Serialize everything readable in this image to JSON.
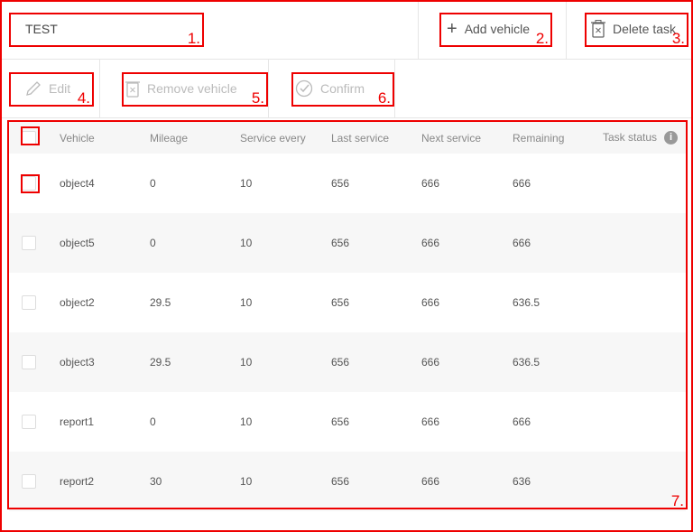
{
  "header": {
    "title": "TEST",
    "add_vehicle": "Add vehicle",
    "delete_task": "Delete task"
  },
  "toolbar": {
    "edit": "Edit",
    "remove_vehicle": "Remove vehicle",
    "confirm": "Confirm"
  },
  "table": {
    "columns": [
      "Vehicle",
      "Mileage",
      "Service every",
      "Last service",
      "Next service",
      "Remaining",
      "Task status"
    ],
    "rows": [
      [
        "object4",
        "0",
        "10",
        "656",
        "666",
        "666",
        ""
      ],
      [
        "object5",
        "0",
        "10",
        "656",
        "666",
        "666",
        ""
      ],
      [
        "object2",
        "29.5",
        "10",
        "656",
        "666",
        "636.5",
        ""
      ],
      [
        "object3",
        "29.5",
        "10",
        "656",
        "666",
        "636.5",
        ""
      ],
      [
        "report1",
        "0",
        "10",
        "656",
        "666",
        "666",
        ""
      ],
      [
        "report2",
        "30",
        "10",
        "656",
        "666",
        "636",
        ""
      ]
    ]
  },
  "annotations": [
    "1.",
    "2.",
    "3.",
    "4.",
    "5.",
    "6.",
    "7."
  ],
  "colors": {
    "annotation": "#ee0000"
  }
}
